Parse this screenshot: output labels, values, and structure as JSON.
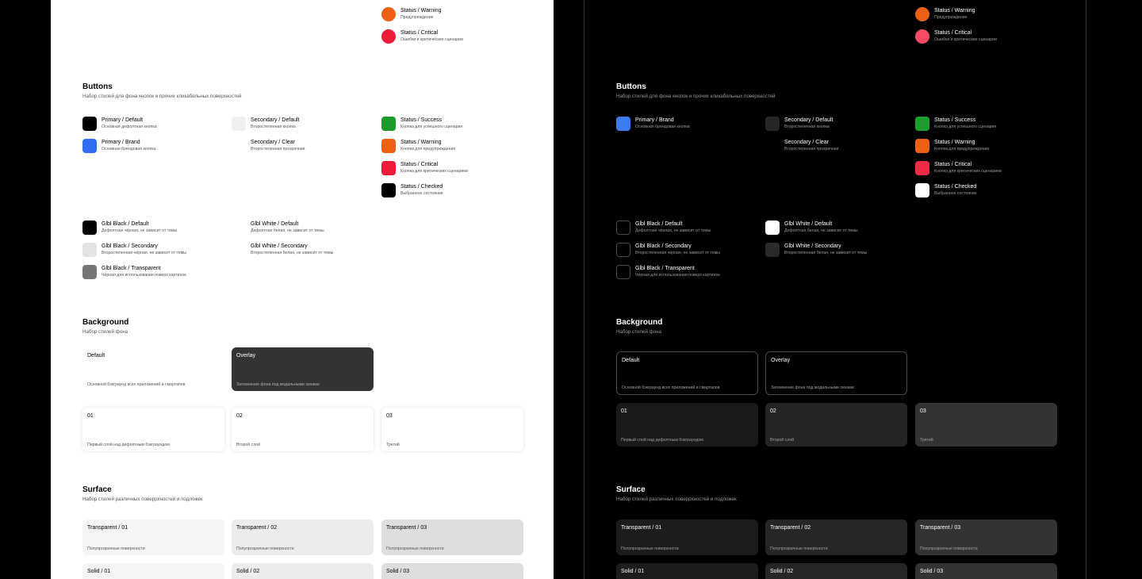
{
  "colors": {
    "warning": "#eb6014",
    "critical_light": "#ee1c39",
    "critical_dark": "#f74a64",
    "success": "#1c9a2a",
    "brand": "#2f6ef0",
    "black": "#000000",
    "light_gray": "#efefef",
    "dark_gray": "#262626"
  },
  "status_top": [
    {
      "name": "Status / Warning",
      "desc": "Предупреждение"
    },
    {
      "name": "Status / Critical",
      "desc": "Ошибки и критические сценарии"
    }
  ],
  "buttons": {
    "title": "Buttons",
    "subtitle": "Набор стилей для фона кнопок и прочих кликабельных поверхностей",
    "light_primary": [
      {
        "name": "Primary / Default",
        "desc": "Основная дефолтная кнопка"
      },
      {
        "name": "Primary / Brand",
        "desc": "Основная брендовая кнопка"
      }
    ],
    "dark_primary": [
      {
        "name": "Primary / Brand",
        "desc": "Основная брендовая кнопка"
      }
    ],
    "secondary": [
      {
        "name": "Secondary / Default",
        "desc": "Второстепенная кнопка"
      },
      {
        "name": "Secondary / Clear",
        "desc": "Второстепенная прозрачная"
      }
    ],
    "status": [
      {
        "name": "Status / Success",
        "desc": "Кнопка для успешного сценария"
      },
      {
        "name": "Status / Warning",
        "desc": "Кнопка для предупреждения"
      },
      {
        "name": "Status / Critical",
        "desc": "Кнопка для критических сценариев"
      },
      {
        "name": "Status / Checked",
        "desc": "Выбранное состояние"
      }
    ],
    "glbl_black": [
      {
        "name": "Glbl Black / Default",
        "desc": "Дефолтная чёрная, не зависит от темы"
      },
      {
        "name": "Glbl Black / Secondary",
        "desc": "Второстепенная чёрная, не зависит от темы"
      },
      {
        "name": "Glbl Black / Transparent",
        "desc": "Чёрная для использования поверх картинок"
      }
    ],
    "glbl_white": [
      {
        "name": "Glbl White / Default",
        "desc": "Дефолтная белая, не зависит от темы"
      },
      {
        "name": "Glbl White / Secondary",
        "desc": "Второстепенная белая, не зависит от темы"
      }
    ]
  },
  "background": {
    "title": "Background",
    "subtitle": "Набор стилей фона",
    "cards_top": [
      {
        "name": "Default",
        "desc": "Основной бэкграунд всех приложений и смартапов"
      },
      {
        "name": "Overlay",
        "desc": "Затемнение фона под модальными окнами"
      }
    ],
    "cards_layers": [
      {
        "name": "01",
        "desc": "Первый слой над дефолтным бэкграундом"
      },
      {
        "name": "02",
        "desc": "Второй слой"
      },
      {
        "name": "03",
        "desc": "Третий"
      }
    ]
  },
  "surface": {
    "title": "Surface",
    "subtitle": "Набор стилей различных поверрхностей и подложек",
    "transparent": [
      {
        "name": "Transparent / 01",
        "desc": "Полупрозрачные поверхности"
      },
      {
        "name": "Transparent / 02",
        "desc": "Полупрозрачные поверхности"
      },
      {
        "name": "Transparent / 03",
        "desc": "Полупрозрачные поверхности"
      }
    ],
    "solid": [
      {
        "name": "Solid / 01"
      },
      {
        "name": "Solid / 02"
      },
      {
        "name": "Solid / 03"
      }
    ]
  }
}
